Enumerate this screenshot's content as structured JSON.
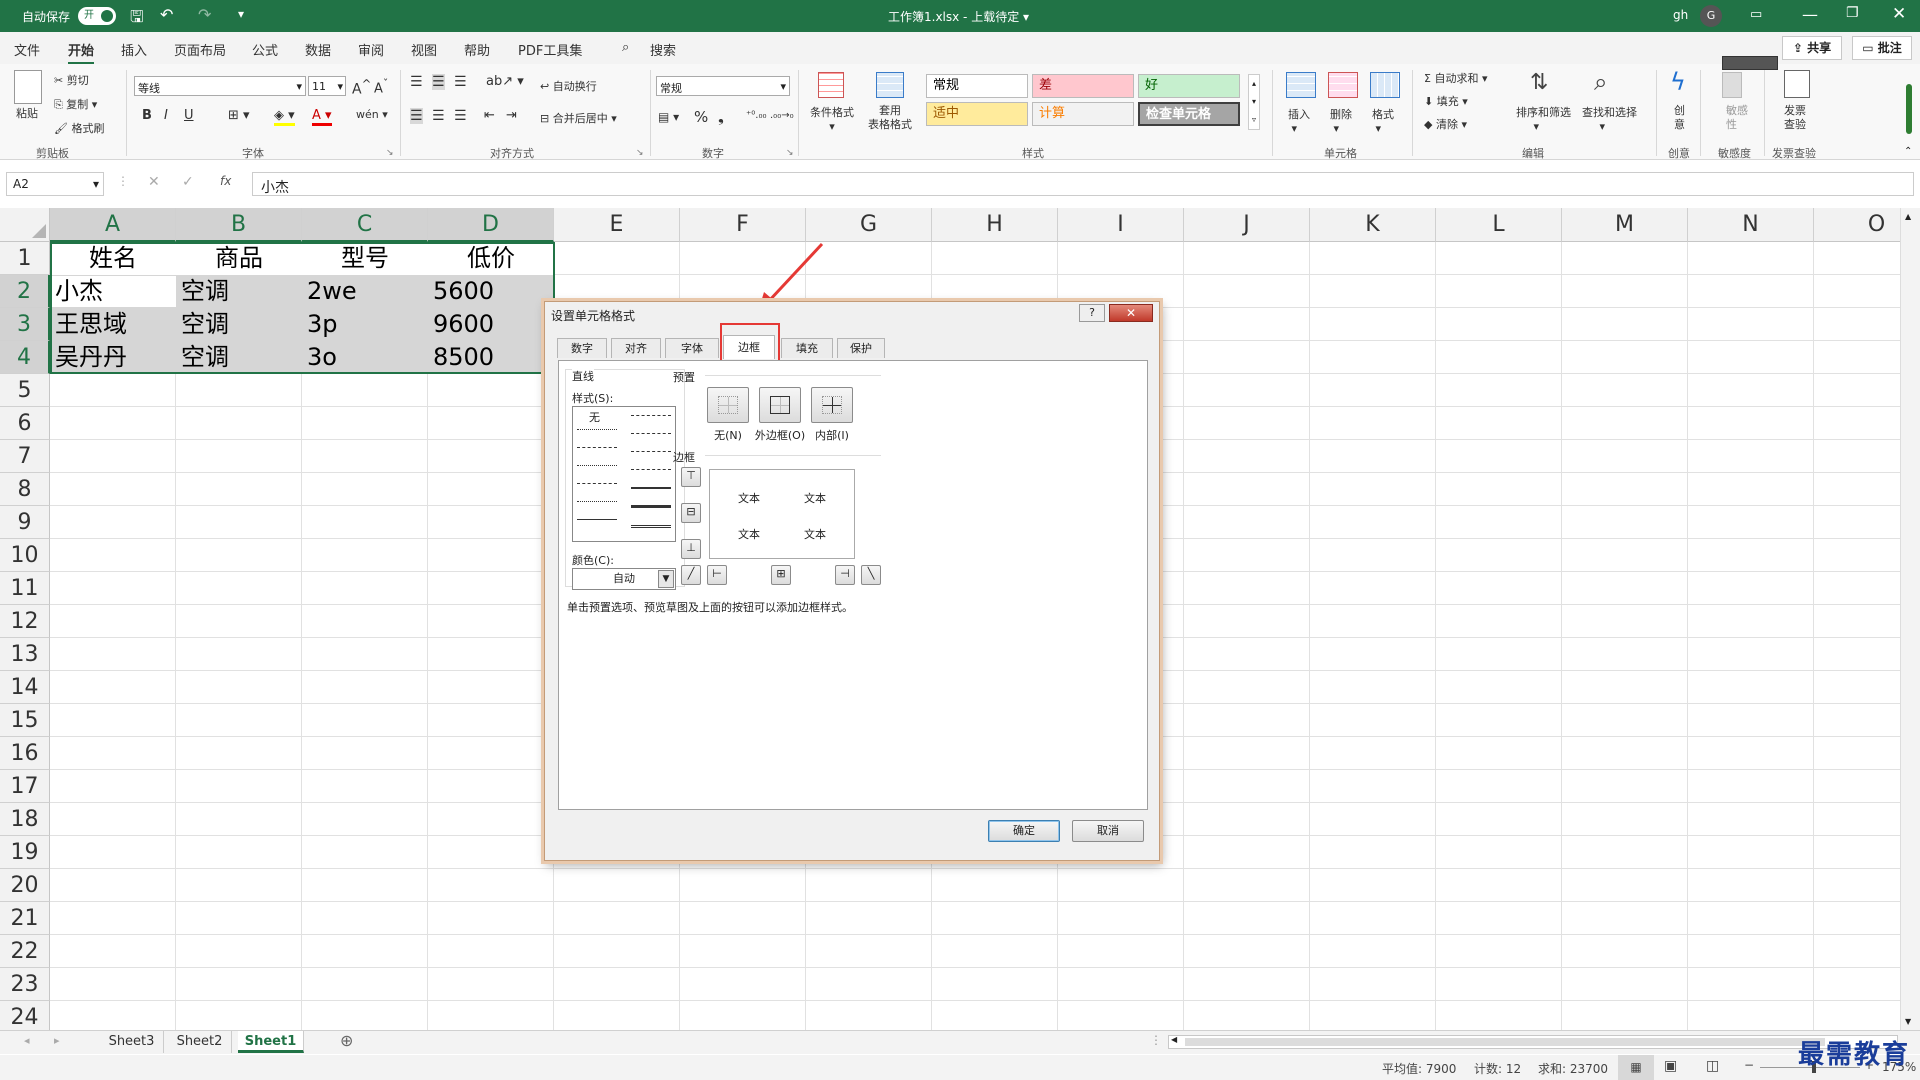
{
  "title": {
    "autosave_label": "自动保存",
    "autosave_state": "开",
    "doc_title": "工作簿1.xlsx - 上载待定 ▾",
    "user": "gh",
    "avatar_letter": "G"
  },
  "tabs": [
    "文件",
    "开始",
    "插入",
    "页面布局",
    "公式",
    "数据",
    "审阅",
    "视图",
    "帮助",
    "PDF工具集"
  ],
  "search_label": "搜索",
  "share_label": "共享",
  "comment_label": "批注",
  "ribbon": {
    "clipboard": {
      "paste": "粘贴",
      "cut": "剪切",
      "copy": "复制",
      "format_painter": "格式刷",
      "label": "剪贴板"
    },
    "font": {
      "name": "等线",
      "size": "11",
      "label": "字体",
      "bold": "B",
      "italic": "I",
      "underline": "U"
    },
    "align": {
      "wrap": "自动换行",
      "merge": "合并后居中",
      "label": "对齐方式"
    },
    "number": {
      "format": "常规",
      "label": "数字"
    },
    "styles": {
      "cond": "条件格式",
      "table": "套用\n表格格式",
      "label": "样式",
      "cells": [
        {
          "text": "常规",
          "bg": "#ffffff",
          "fg": "#000000"
        },
        {
          "text": "差",
          "bg": "#ffc7ce",
          "fg": "#9c0006"
        },
        {
          "text": "好",
          "bg": "#c6efce",
          "fg": "#006100"
        },
        {
          "text": "适中",
          "bg": "#ffeb9c",
          "fg": "#9c5700"
        },
        {
          "text": "计算",
          "bg": "#f2f2f2",
          "fg": "#fa7d00"
        },
        {
          "text": "检查单元格",
          "bg": "#a5a5a5",
          "fg": "#ffffff"
        }
      ]
    },
    "cells": {
      "insert": "插入",
      "delete": "删除",
      "format": "格式",
      "label": "单元格"
    },
    "editing": {
      "autosum": "自动求和",
      "fill": "填充",
      "clear": "清除",
      "sort": "排序和筛选",
      "find": "查找和选择",
      "label": "编辑"
    },
    "creative": {
      "btn": "创\n意",
      "label": "创意"
    },
    "sensitivity": {
      "btn": "敏感\n性",
      "label": "敏感度"
    },
    "invoice": {
      "btn": "发票\n查验",
      "label": "发票查验"
    }
  },
  "formula_bar": {
    "name_box": "A2",
    "fx": "fx",
    "value": "小杰"
  },
  "columns": [
    "A",
    "B",
    "C",
    "D",
    "E",
    "F",
    "G",
    "H",
    "I",
    "J",
    "K",
    "L",
    "M",
    "N",
    "O"
  ],
  "rows": [
    "1",
    "2",
    "3",
    "4",
    "5",
    "6",
    "7",
    "8",
    "9",
    "10",
    "11",
    "12",
    "13",
    "14",
    "15",
    "16",
    "17",
    "18",
    "19",
    "20",
    "21",
    "22",
    "23",
    "24"
  ],
  "table": {
    "header": [
      "姓名",
      "商品",
      "型号",
      "低价"
    ],
    "rows": [
      [
        "小杰",
        "空调",
        "2we",
        "5600"
      ],
      [
        "王思域",
        "空调",
        "3p",
        "9600"
      ],
      [
        "吴丹丹",
        "空调",
        "3o",
        "8500"
      ]
    ]
  },
  "dialog": {
    "title": "设置单元格格式",
    "help": "?",
    "tabs": [
      "数字",
      "对齐",
      "字体",
      "边框",
      "填充",
      "保护"
    ],
    "active_tab": "边框",
    "line_section": "直线",
    "style_label": "样式(S):",
    "style_none": "无",
    "color_label": "颜色(C):",
    "color_value": "自动",
    "preset_section": "预置",
    "presets": [
      "无(N)",
      "外边框(O)",
      "内部(I)"
    ],
    "border_section": "边框",
    "preview_text": [
      "文本",
      "文本",
      "文本",
      "文本"
    ],
    "hint": "单击预置选项、预览草图及上面的按钮可以添加边框样式。",
    "ok": "确定",
    "cancel": "取消"
  },
  "sheets": [
    "Sheet3",
    "Sheet2",
    "Sheet1"
  ],
  "active_sheet": "Sheet1",
  "status": {
    "avg": "平均值: 7900",
    "count": "计数: 12",
    "sum": "求和: 23700",
    "zoom": "175%"
  },
  "watermark": "最需教育",
  "accent": "#217346",
  "highlight": "#e53935"
}
